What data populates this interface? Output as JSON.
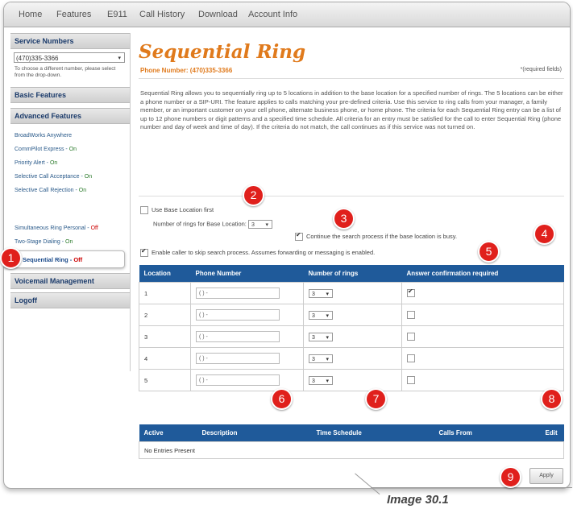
{
  "nav": [
    "Home",
    "Features",
    "E911",
    "Call History",
    "Download",
    "Account Info"
  ],
  "sidebar": {
    "service_numbers_title": "Service Numbers",
    "selected_number": "(470)335-3366",
    "note": "To choose a different number, please select from the drop-down.",
    "basic_features": "Basic Features",
    "advanced_features": "Advanced Features",
    "items": [
      {
        "label": "BroadWorks Anywhere",
        "status": ""
      },
      {
        "label": "CommPilot Express",
        "status": "On"
      },
      {
        "label": "Priority Alert",
        "status": "On"
      },
      {
        "label": "Selective Call Acceptance",
        "status": "On"
      },
      {
        "label": "Selective Call Rejection",
        "status": "On"
      },
      {
        "label": "Sequential Ring",
        "status": "Off"
      },
      {
        "label": "Simultaneous Ring Personal",
        "status": "Off"
      },
      {
        "label": "Two-Stage Dialing",
        "status": "On"
      }
    ],
    "voicemail": "Voicemail Management",
    "logoff": "Logoff"
  },
  "page": {
    "title": "Sequential Ring",
    "phone_number": "Phone Number: (470)335-3366",
    "required_note": "*(required fields)",
    "description": "Sequential Ring allows you to sequentially ring up to 5 locations in addition to the base location for a specified number of rings. The 5 locations can be either a phone number or a SIP-URI. The feature applies to calls matching your pre-defined criteria. Use this service to ring calls from your manager, a family member, or an important customer on your cell phone, alternate business phone, or home phone. The criteria for each Sequential Ring entry can be a list of up to 12 phone numbers or digit patterns and a specified time schedule. All criteria for an entry must be satisfied for the call to enter Sequential Ring (phone number and day of week and time of day). If the criteria do not match, the call continues as if this service was not turned on.",
    "use_base_location": "Use Base Location first",
    "rings_for_base_label": "Number of rings for Base Location:",
    "rings_for_base_value": "3",
    "continue_search": "Continue the search process if the base location is busy.",
    "enable_skip": "Enable caller to skip search process. Assumes forwarding or messaging is enabled.",
    "apply": "Apply"
  },
  "locations_table": {
    "headers": [
      "Location",
      "Phone Number",
      "Number of rings",
      "Answer confirmation required"
    ],
    "rows": [
      {
        "location": "1",
        "phone": "( ) -",
        "rings": "3",
        "confirm": true
      },
      {
        "location": "2",
        "phone": "( ) -",
        "rings": "3",
        "confirm": false
      },
      {
        "location": "3",
        "phone": "( ) -",
        "rings": "3",
        "confirm": false
      },
      {
        "location": "4",
        "phone": "( ) -",
        "rings": "3",
        "confirm": false
      },
      {
        "location": "5",
        "phone": "( ) -",
        "rings": "3",
        "confirm": false
      }
    ]
  },
  "entries_table": {
    "headers": [
      "Active",
      "Description",
      "Time Schedule",
      "Calls From",
      "Edit"
    ],
    "empty": "No Entries Present"
  },
  "badges": [
    "1",
    "2",
    "3",
    "4",
    "5",
    "6",
    "7",
    "8",
    "9"
  ],
  "caption": "Image 30.1",
  "colors": {
    "accent": "#e07a1c",
    "header_blue": "#1f5a9a",
    "badge_red": "#e0201c",
    "status_on": "#2a7a2a",
    "status_off": "#cc0000"
  }
}
